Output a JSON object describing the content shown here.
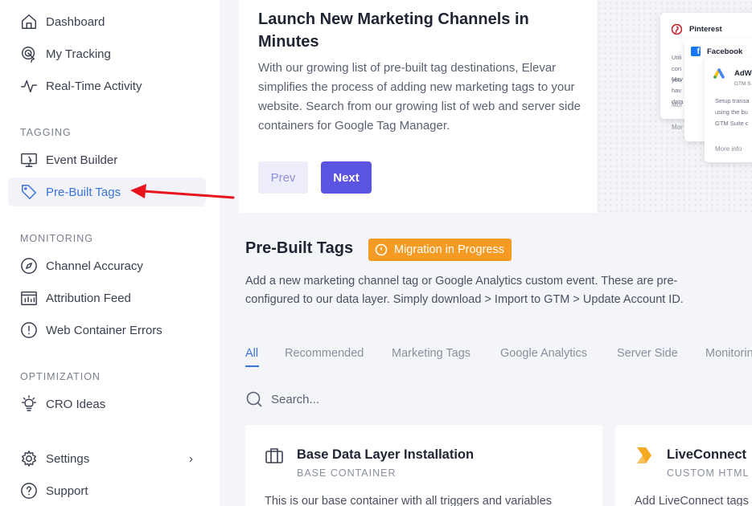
{
  "sidebar": {
    "items_top": [
      {
        "label": "Dashboard",
        "icon": "home-icon"
      },
      {
        "label": "My Tracking",
        "icon": "tracking-icon"
      },
      {
        "label": "Real-Time Activity",
        "icon": "activity-icon"
      }
    ],
    "sections": {
      "tagging": "TAGGING",
      "monitoring": "MONITORING",
      "optimization": "OPTIMIZATION"
    },
    "tagging_items": [
      {
        "label": "Event Builder",
        "icon": "monitor-icon"
      },
      {
        "label": "Pre-Built Tags",
        "icon": "tag-icon",
        "active": true
      }
    ],
    "monitoring_items": [
      {
        "label": "Channel Accuracy",
        "icon": "compass-icon"
      },
      {
        "label": "Attribution Feed",
        "icon": "feed-icon"
      },
      {
        "label": "Web Container Errors",
        "icon": "alert-icon"
      }
    ],
    "optimization_items": [
      {
        "label": "CRO Ideas",
        "icon": "lightbulb-icon"
      }
    ],
    "bottom_items": [
      {
        "label": "Settings",
        "icon": "gear-icon",
        "chevron": "›"
      },
      {
        "label": "Support",
        "icon": "help-icon"
      }
    ]
  },
  "hero": {
    "title": "Launch New Marketing Channels in Minutes",
    "description": "With our growing list of pre-built tag destinations, Elevar simplifies the process of adding new marketing tags to your website. Search from our growing list of web and server side containers for Google Tag Manager.",
    "prev_label": "Prev",
    "next_label": "Next",
    "art": {
      "pinterest": {
        "title": "Pinterest",
        "text1": "Utili",
        "text2": "con",
        "text3": "you",
        "more": "Mor"
      },
      "facebook": {
        "title": "Facebook",
        "text1": "Mov",
        "text2": "hav",
        "text3": "data",
        "more": "Mor"
      },
      "adwords": {
        "title": "AdWo",
        "subtitle": "GTM S",
        "text1": "Setup transa",
        "text2": "using the bu",
        "text3": "GTM Suite c",
        "more": "More info"
      }
    }
  },
  "prebuilt": {
    "title": "Pre-Built Tags",
    "badge": "Migration in Progress",
    "description": "Add a new marketing channel tag or Google Analytics custom event. These are pre-configured to our data layer. Simply download > Import to GTM > Update Account ID."
  },
  "tabs": [
    "All",
    "Recommended",
    "Marketing Tags",
    "Google Analytics",
    "Server Side",
    "Monitorin"
  ],
  "search": {
    "placeholder": "Search..."
  },
  "cards": [
    {
      "name": "Base Data Layer Installation",
      "subtitle": "BASE CONTAINER",
      "description": "This is our base container with all triggers and variables",
      "icon": "briefcase-icon"
    },
    {
      "name": "LiveConnect",
      "subtitle": "CUSTOM HTML",
      "description": "Add LiveConnect tags",
      "icon": "liveconnect-logo-icon"
    }
  ],
  "colors": {
    "accent": "#3b73d8",
    "primary_button": "#5b54e0",
    "badge": "#f59a23",
    "annotation_arrow": "#e8141c"
  }
}
